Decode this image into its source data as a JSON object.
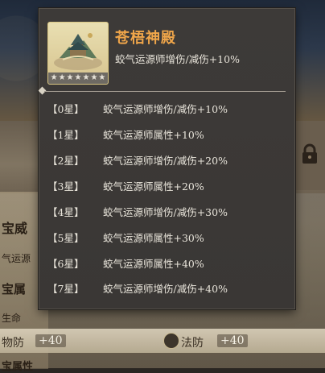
{
  "background": {
    "left_labels": [
      "宝威",
      "气运源",
      "宝属",
      "生命"
    ],
    "bottom_stats": [
      {
        "label": "物防",
        "value": "+40"
      },
      {
        "label": "法防",
        "value": "+40"
      }
    ],
    "bottom_cut_label": "宝属性"
  },
  "tooltip": {
    "item": {
      "name": "苍梧神殿",
      "description": "蛟气运源师增伤/减伤+10%",
      "stars": [
        "★",
        "★",
        "★",
        "★",
        "★",
        "★",
        "★"
      ],
      "icon": "palace-icon"
    },
    "levels": [
      {
        "label": "【0星】",
        "effect": "蛟气运源师增伤/减伤+10%"
      },
      {
        "label": "【1星】",
        "effect": "蛟气运源师属性+10%"
      },
      {
        "label": "【2星】",
        "effect": "蛟气运源师增伤/减伤+20%"
      },
      {
        "label": "【3星】",
        "effect": "蛟气运源师属性+20%"
      },
      {
        "label": "【4星】",
        "effect": "蛟气运源师增伤/减伤+30%"
      },
      {
        "label": "【5星】",
        "effect": "蛟气运源师属性+30%"
      },
      {
        "label": "【6星】",
        "effect": "蛟气运源师属性+40%"
      },
      {
        "label": "【7星】",
        "effect": "蛟气运源师增伤/减伤+40%"
      }
    ]
  },
  "colors": {
    "title": "#f0a64a",
    "text": "#e8e4da",
    "panel": "#3a3735"
  }
}
